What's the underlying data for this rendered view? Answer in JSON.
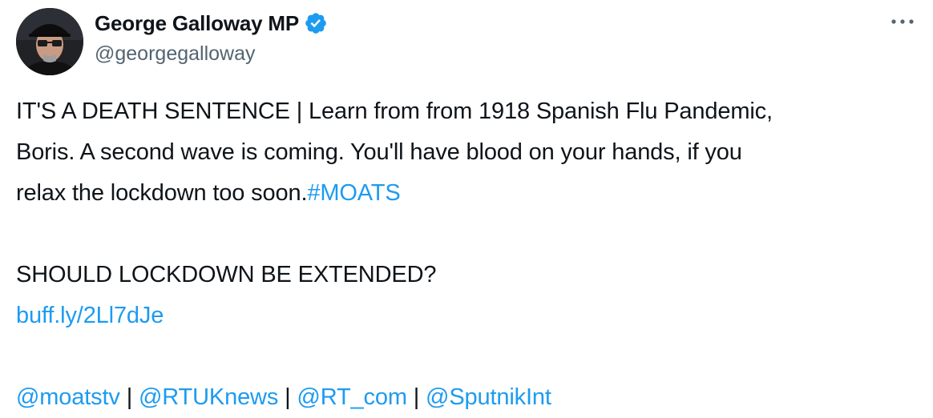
{
  "author": {
    "display_name": "George Galloway MP",
    "handle": "@georgegalloway",
    "verified_icon": "verified-badge-icon",
    "verified_color": "#1d9bf0"
  },
  "more_icon": "more-options-icon",
  "tweet": {
    "line1": "IT'S A DEATH SENTENCE | Learn from from 1918 Spanish Flu Pandemic,",
    "line2": "Boris. A second wave is coming. You'll have blood on your hands, if you",
    "line3_text": "relax the lockdown too soon.",
    "hashtag": "#MOATS",
    "question": "SHOULD LOCKDOWN BE EXTENDED?",
    "link": "buff.ly/2Ll7dJe",
    "mentions": [
      "@moatstv",
      "@RTUKnews",
      "@RT_com",
      "@SputnikInt"
    ],
    "separator": " | "
  },
  "colors": {
    "text": "#0f1419",
    "secondary": "#536471",
    "link": "#1d9bf0"
  }
}
